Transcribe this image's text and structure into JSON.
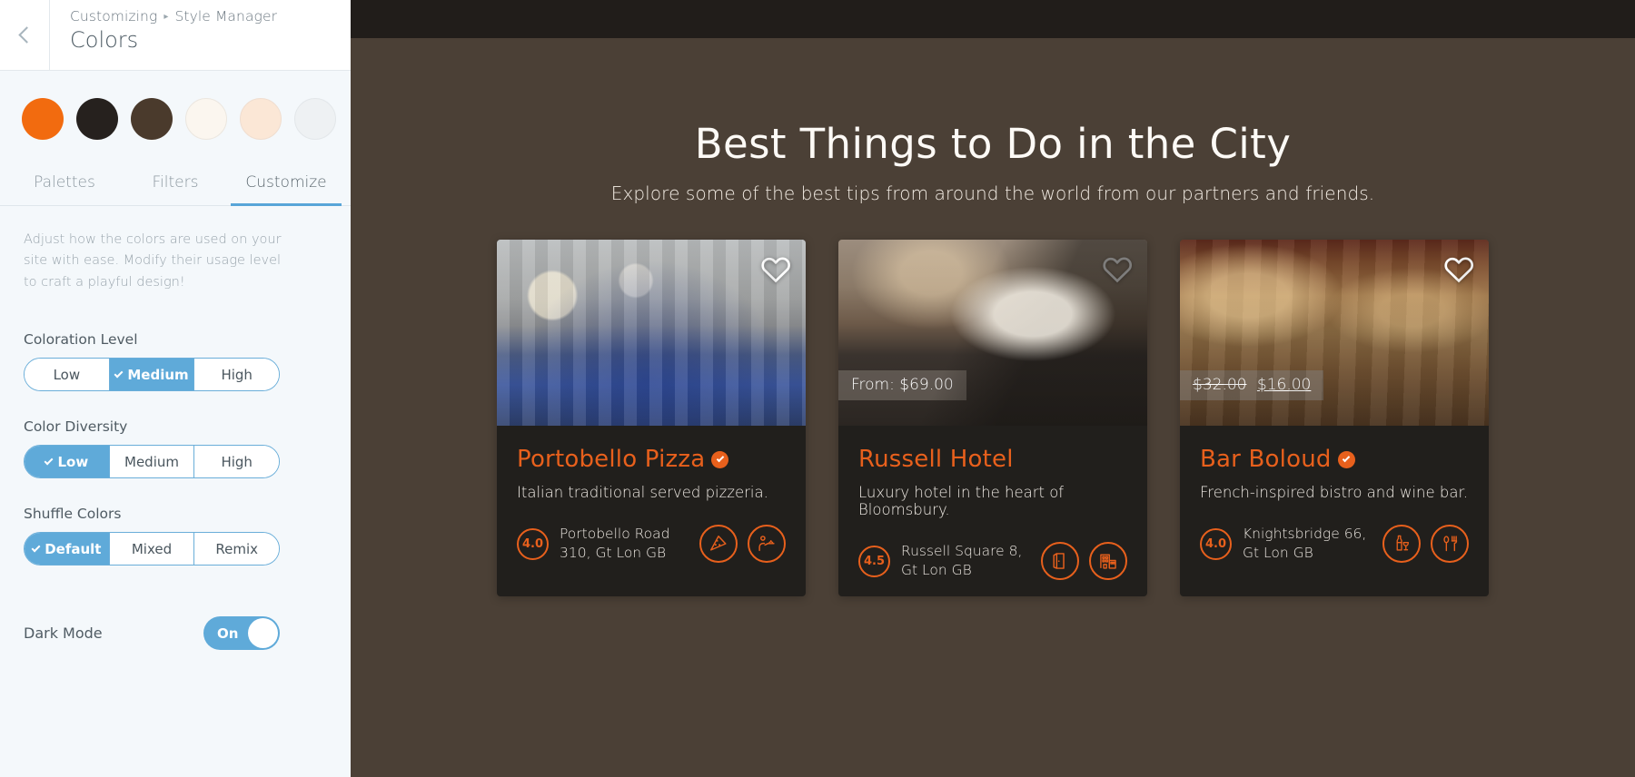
{
  "sidebar": {
    "back_icon": "chevron-left-icon",
    "breadcrumb_root": "Customizing",
    "breadcrumb_sep": "▸",
    "breadcrumb_current": "Style Manager",
    "panel_title": "Colors",
    "swatches": [
      {
        "name": "accent-orange",
        "hex": "#f26b0f"
      },
      {
        "name": "near-black",
        "hex": "#26211e"
      },
      {
        "name": "dark-brown",
        "hex": "#4a3a2c"
      },
      {
        "name": "off-white",
        "hex": "#fbf6ef"
      },
      {
        "name": "cream",
        "hex": "#fbe7d6"
      },
      {
        "name": "light-grey",
        "hex": "#eef1f3"
      }
    ],
    "tabs": [
      {
        "label": "Palettes",
        "active": false
      },
      {
        "label": "Filters",
        "active": false
      },
      {
        "label": "Customize",
        "active": true
      }
    ],
    "description": "Adjust how the colors are used on your site with ease. Modify their usage level to craft a playful design!",
    "groups": [
      {
        "label": "Coloration Level",
        "name": "coloration-level",
        "options": [
          {
            "label": "Low",
            "selected": false
          },
          {
            "label": "Medium",
            "selected": true
          },
          {
            "label": "High",
            "selected": false
          }
        ]
      },
      {
        "label": "Color Diversity",
        "name": "color-diversity",
        "options": [
          {
            "label": "Low",
            "selected": true
          },
          {
            "label": "Medium",
            "selected": false
          },
          {
            "label": "High",
            "selected": false
          }
        ]
      },
      {
        "label": "Shuffle Colors",
        "name": "shuffle-colors",
        "options": [
          {
            "label": "Default",
            "selected": true
          },
          {
            "label": "Mixed",
            "selected": false
          },
          {
            "label": "Remix",
            "selected": false
          }
        ]
      }
    ],
    "dark_mode": {
      "label": "Dark Mode",
      "state": "On"
    },
    "accent_color": "#5faad9"
  },
  "preview": {
    "hero": {
      "title": "Best Things to Do in the City",
      "subtitle": "Explore some of the best tips from around the world from our partners and friends."
    },
    "cards": [
      {
        "image_name": "restaurant-interior-photo",
        "favorite_icon": "heart-icon",
        "price_badge": null,
        "price_old": null,
        "price_new": null,
        "title": "Portobello Pizza",
        "verified_icon": "verified-check-icon",
        "subtitle": "Italian traditional served pizzeria.",
        "rating": "4.0",
        "address": "Portobello Road 310, Gt Lon GB",
        "features": [
          {
            "name": "pizza-slice-icon"
          },
          {
            "name": "waiter-service-icon"
          }
        ]
      },
      {
        "image_name": "hotel-bedroom-photo",
        "favorite_icon": "heart-icon",
        "price_badge": "From: $69.00",
        "price_old": null,
        "price_new": null,
        "title": "Russell Hotel",
        "verified_icon": null,
        "subtitle": "Luxury hotel in the heart of Bloomsbury.",
        "rating": "4.5",
        "address": "Russell Square 8, Gt Lon GB",
        "features": [
          {
            "name": "door-icon"
          },
          {
            "name": "building-icon"
          }
        ]
      },
      {
        "image_name": "bistro-dining-photo",
        "favorite_icon": "heart-icon",
        "price_badge": null,
        "price_old": "$32.00",
        "price_new": "$16.00",
        "title": "Bar Boloud",
        "verified_icon": "verified-check-icon",
        "subtitle": "French-inspired bistro and wine bar.",
        "rating": "4.0",
        "address": "Knightsbridge 66, Gt Lon GB",
        "features": [
          {
            "name": "wine-bottle-glass-icon"
          },
          {
            "name": "cutlery-icon"
          }
        ]
      }
    ],
    "theme": {
      "accent": "#e8601c",
      "background": "#4b4036",
      "card_background": "#211f1c",
      "topbar": "#211d1a"
    }
  }
}
